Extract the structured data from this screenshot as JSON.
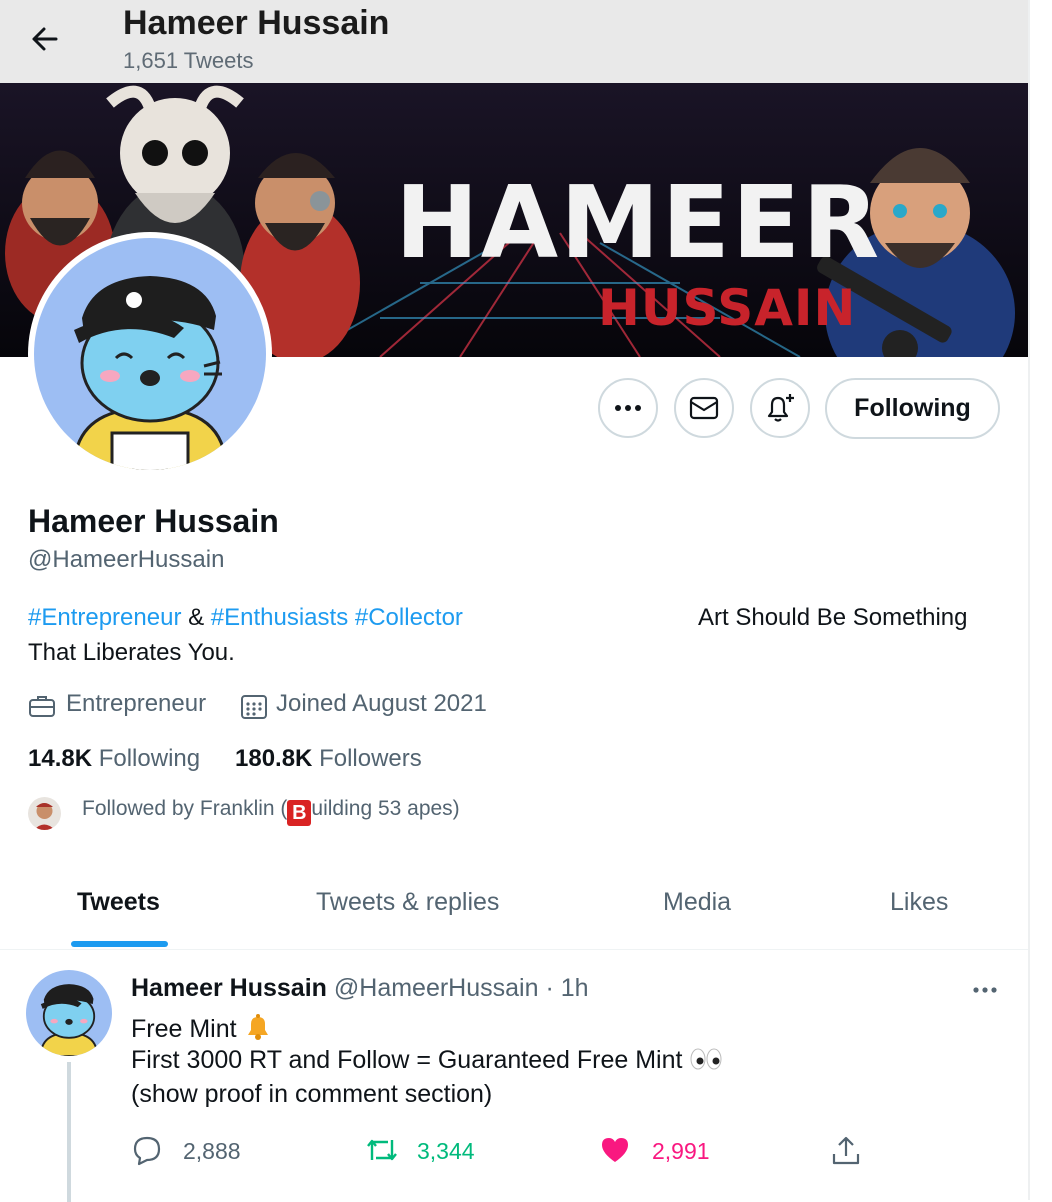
{
  "header": {
    "back_icon": "arrow-left-icon",
    "title": "Hameer Hussain",
    "tweet_count": "1,651 Tweets"
  },
  "banner": {
    "title_word": "HAMEER",
    "subtitle_word": "HUSSAIN"
  },
  "actions": {
    "more_icon": "more-horizontal-icon",
    "message_icon": "mail-icon",
    "notify_icon": "bell-plus-icon",
    "follow_label": "Following"
  },
  "profile": {
    "name": "Hameer Hussain",
    "handle": "@HameerHussain",
    "bio": {
      "tag1": "#Entrepreneur",
      "joiner": " & ",
      "tag2": "#Enthusiasts",
      "tag3": "#Collector",
      "right_text": "Art Should Be Something",
      "line2": "That Liberates You."
    },
    "profession": "Entrepreneur",
    "joined": "Joined August 2021",
    "following_count": "14.8K",
    "following_label": "Following",
    "followers_count": "180.8K",
    "followers_label": "Followers",
    "followed_by_prefix": "Followed by Franklin (",
    "followed_by_badge": "B",
    "followed_by_suffix": "uilding 53 apes)"
  },
  "tabs": [
    {
      "label": "Tweets",
      "active": true
    },
    {
      "label": "Tweets & replies",
      "active": false
    },
    {
      "label": "Media",
      "active": false
    },
    {
      "label": "Likes",
      "active": false
    }
  ],
  "tweet": {
    "author": "Hameer Hussain",
    "handle": "@HameerHussain",
    "separator": "·",
    "time": "1h",
    "line1": "Free Mint",
    "line2": "First 3000 RT and Follow  = Guaranteed Free Mint",
    "line3": "(show proof in comment section)",
    "replies": "2,888",
    "retweets": "3,344",
    "likes": "2,991",
    "colors": {
      "retweet": "#00ba7c",
      "like": "#f91880",
      "link": "#1d9bf0"
    }
  }
}
